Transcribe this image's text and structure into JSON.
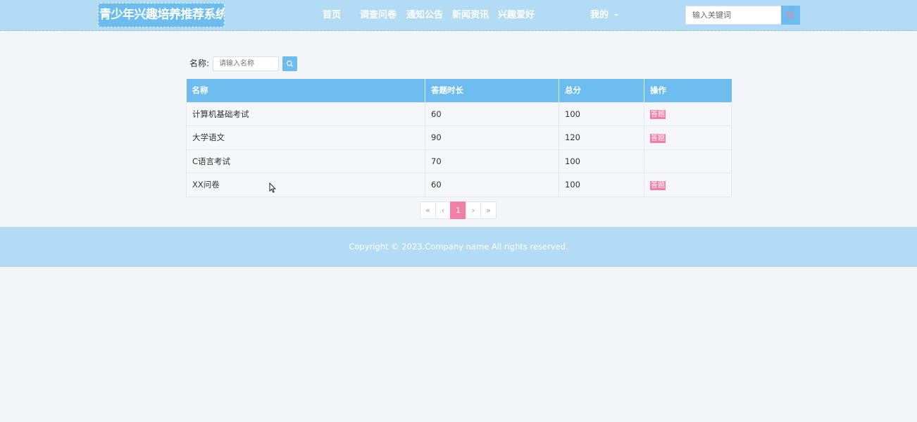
{
  "header": {
    "logo": "青少年兴趣培养推荐系统",
    "nav": [
      "首页",
      "调查问卷",
      "通知公告",
      "新闻资讯",
      "兴趣爱好"
    ],
    "mine": "我的",
    "search_placeholder": "输入关键词"
  },
  "filter": {
    "label": "名称:",
    "placeholder": "请输入名称"
  },
  "table": {
    "headers": [
      "名称",
      "答题时长",
      "总分",
      "操作"
    ],
    "rows": [
      {
        "name": "计算机基础考试",
        "duration": "60",
        "score": "100",
        "action": "答题"
      },
      {
        "name": "大学语文",
        "duration": "90",
        "score": "120",
        "action": "答题"
      },
      {
        "name": "C语言考试",
        "duration": "70",
        "score": "100",
        "action": ""
      },
      {
        "name": "XX问卷",
        "duration": "60",
        "score": "100",
        "action": "答题"
      }
    ]
  },
  "pager": {
    "first": "«",
    "prev": "‹",
    "current": "1",
    "next": "›",
    "last": "»"
  },
  "footer": {
    "copyright": "Copyright © 2023.Company name All rights reserved."
  },
  "colors": {
    "brand": "#6cbcef",
    "header_bg": "#b3dbf3",
    "accent": "#f27fa6"
  }
}
